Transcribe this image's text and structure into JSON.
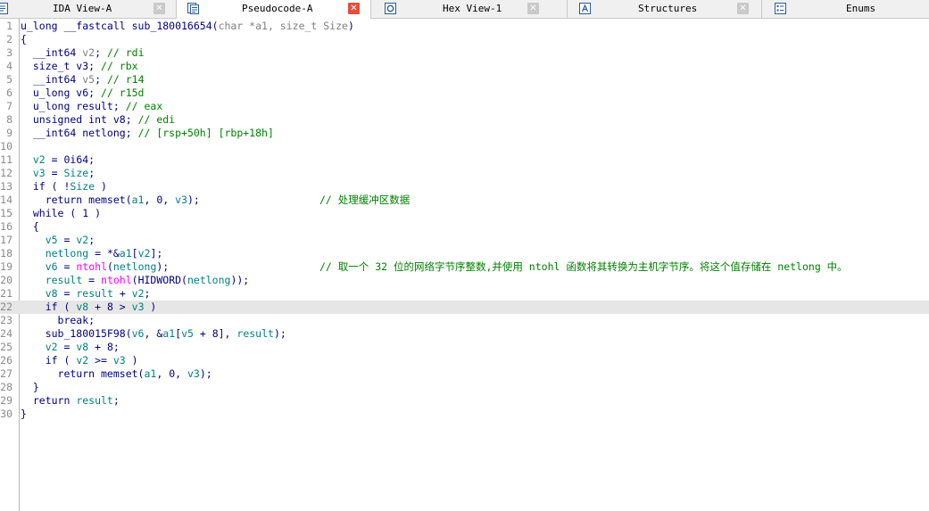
{
  "tabs": [
    {
      "label": "IDA View-A",
      "icon": "disassembly-icon",
      "active": false
    },
    {
      "label": "Pseudocode-A",
      "icon": "pseudocode-icon",
      "active": true
    },
    {
      "label": "Hex View-1",
      "icon": "hex-view-icon",
      "active": false
    },
    {
      "label": "Structures",
      "icon": "structures-icon",
      "active": false
    },
    {
      "label": "Enums",
      "icon": "enums-icon",
      "active": false
    }
  ],
  "close_glyph": "✕",
  "code": {
    "lines": [
      {
        "n": "1",
        "parts": [
          [
            "k",
            "u_long __fastcall sub_180016654("
          ],
          [
            "g",
            "char *a1, size_t Size"
          ],
          [
            "k",
            ")"
          ]
        ]
      },
      {
        "n": "2",
        "parts": [
          [
            "k",
            "{"
          ]
        ]
      },
      {
        "n": "3",
        "parts": [
          [
            "k",
            "  __int64 "
          ],
          [
            "g",
            "v2"
          ],
          [
            "k",
            "; "
          ],
          [
            "c",
            "// rdi"
          ]
        ]
      },
      {
        "n": "4",
        "parts": [
          [
            "k",
            "  size_t v3; "
          ],
          [
            "c",
            "// rbx"
          ]
        ]
      },
      {
        "n": "5",
        "parts": [
          [
            "k",
            "  __int64 "
          ],
          [
            "g",
            "v5"
          ],
          [
            "k",
            "; "
          ],
          [
            "c",
            "// r14"
          ]
        ]
      },
      {
        "n": "6",
        "parts": [
          [
            "k",
            "  u_long v6; "
          ],
          [
            "c",
            "// r15d"
          ]
        ]
      },
      {
        "n": "7",
        "parts": [
          [
            "k",
            "  u_long result; "
          ],
          [
            "c",
            "// eax"
          ]
        ]
      },
      {
        "n": "8",
        "parts": [
          [
            "k",
            "  unsigned int v8; "
          ],
          [
            "c",
            "// edi"
          ]
        ]
      },
      {
        "n": "9",
        "parts": [
          [
            "k",
            "  __int64 netlong; "
          ],
          [
            "c",
            "// [rsp+50h] [rbp+18h]"
          ]
        ]
      },
      {
        "n": "10",
        "parts": []
      },
      {
        "n": "11",
        "parts": [
          [
            "k",
            "  "
          ],
          [
            "v",
            "v2"
          ],
          [
            "k",
            " = 0i64;"
          ]
        ]
      },
      {
        "n": "12",
        "parts": [
          [
            "k",
            "  "
          ],
          [
            "v",
            "v3"
          ],
          [
            "k",
            " = "
          ],
          [
            "v",
            "Size"
          ],
          [
            "k",
            ";"
          ]
        ]
      },
      {
        "n": "13",
        "parts": [
          [
            "k",
            "  if ( !"
          ],
          [
            "v",
            "Size"
          ],
          [
            "k",
            " )"
          ]
        ]
      },
      {
        "n": "14",
        "parts": [
          [
            "k",
            "    return memset("
          ],
          [
            "v",
            "a1"
          ],
          [
            "k",
            ", 0, "
          ],
          [
            "v",
            "v3"
          ],
          [
            "k",
            ");"
          ]
        ],
        "comment": "// 处理缓冲区数据"
      },
      {
        "n": "15",
        "parts": [
          [
            "k",
            "  while ( 1 )"
          ]
        ]
      },
      {
        "n": "16",
        "parts": [
          [
            "k",
            "  {"
          ]
        ]
      },
      {
        "n": "17",
        "parts": [
          [
            "k",
            "    "
          ],
          [
            "v",
            "v5"
          ],
          [
            "k",
            " = "
          ],
          [
            "v",
            "v2"
          ],
          [
            "k",
            ";"
          ]
        ]
      },
      {
        "n": "18",
        "parts": [
          [
            "k",
            "    "
          ],
          [
            "v",
            "netlong"
          ],
          [
            "k",
            " = *&"
          ],
          [
            "v",
            "a1"
          ],
          [
            "k",
            "["
          ],
          [
            "v",
            "v2"
          ],
          [
            "k",
            "];"
          ]
        ]
      },
      {
        "n": "19",
        "parts": [
          [
            "k",
            "    "
          ],
          [
            "v",
            "v6"
          ],
          [
            "k",
            " = "
          ],
          [
            "f",
            "ntohl"
          ],
          [
            "k",
            "("
          ],
          [
            "v",
            "netlong"
          ],
          [
            "k",
            ");"
          ]
        ],
        "comment": "// 取一个 32 位的网络字节序整数,并使用 ntohl 函数将其转换为主机字节序。将这个值存储在 netlong 中。"
      },
      {
        "n": "20",
        "parts": [
          [
            "k",
            "    "
          ],
          [
            "v",
            "result"
          ],
          [
            "k",
            " = "
          ],
          [
            "f",
            "ntohl"
          ],
          [
            "k",
            "(HIDWORD("
          ],
          [
            "v",
            "netlong"
          ],
          [
            "k",
            "));"
          ]
        ]
      },
      {
        "n": "21",
        "parts": [
          [
            "k",
            "    "
          ],
          [
            "v",
            "v8"
          ],
          [
            "k",
            " = "
          ],
          [
            "v",
            "result"
          ],
          [
            "k",
            " + "
          ],
          [
            "v",
            "v2"
          ],
          [
            "k",
            ";"
          ]
        ]
      },
      {
        "n": "22",
        "parts": [
          [
            "k",
            "    if ( "
          ],
          [
            "v",
            "v8"
          ],
          [
            "k",
            " + 8 > "
          ],
          [
            "v",
            "v3"
          ],
          [
            "k",
            " )"
          ]
        ],
        "highlight": true
      },
      {
        "n": "23",
        "parts": [
          [
            "k",
            "      break;"
          ]
        ]
      },
      {
        "n": "24",
        "parts": [
          [
            "k",
            "    sub_180015F98("
          ],
          [
            "v",
            "v6"
          ],
          [
            "k",
            ", &"
          ],
          [
            "v",
            "a1"
          ],
          [
            "k",
            "["
          ],
          [
            "v",
            "v5"
          ],
          [
            "k",
            " + 8], "
          ],
          [
            "v",
            "result"
          ],
          [
            "k",
            ");"
          ]
        ]
      },
      {
        "n": "25",
        "parts": [
          [
            "k",
            "    "
          ],
          [
            "v",
            "v2"
          ],
          [
            "k",
            " = "
          ],
          [
            "v",
            "v8"
          ],
          [
            "k",
            " + 8;"
          ]
        ]
      },
      {
        "n": "26",
        "parts": [
          [
            "k",
            "    if ( "
          ],
          [
            "v",
            "v2"
          ],
          [
            "k",
            " >= "
          ],
          [
            "v",
            "v3"
          ],
          [
            "k",
            " )"
          ]
        ]
      },
      {
        "n": "27",
        "parts": [
          [
            "k",
            "      return memset("
          ],
          [
            "v",
            "a1"
          ],
          [
            "k",
            ", 0, "
          ],
          [
            "v",
            "v3"
          ],
          [
            "k",
            ");"
          ]
        ]
      },
      {
        "n": "28",
        "parts": [
          [
            "k",
            "  }"
          ]
        ]
      },
      {
        "n": "29",
        "parts": [
          [
            "k",
            "  return "
          ],
          [
            "v",
            "result"
          ],
          [
            "k",
            ";"
          ]
        ]
      },
      {
        "n": "30",
        "parts": [
          [
            "k",
            "}"
          ]
        ]
      }
    ]
  },
  "colors": {
    "keyword": "#000080",
    "variable": "#008080",
    "comment": "#008000",
    "import_function": "#ff00ff",
    "argument": "#808080",
    "highlight_line": "#e6e6e6",
    "active_tab_close": "#e0513d"
  }
}
